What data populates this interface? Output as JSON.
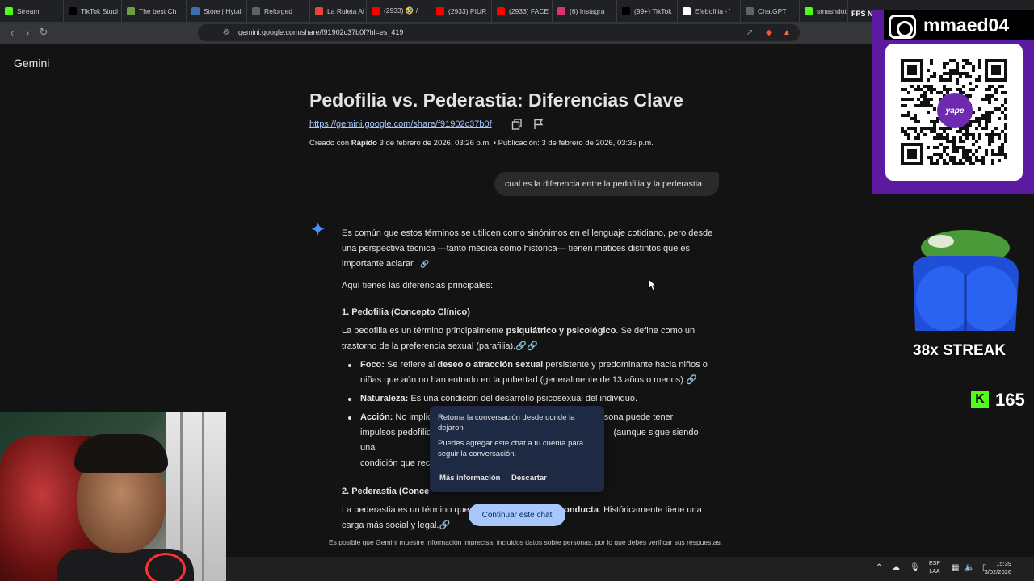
{
  "browser": {
    "tabs": [
      {
        "label": "Stream",
        "icon": "kick-icon",
        "color": "#53fc18"
      },
      {
        "label": "TikTok Studi",
        "icon": "tiktok-icon",
        "color": "#000000"
      },
      {
        "label": "The best Ch",
        "icon": "chess-icon",
        "color": "#6c9d41"
      },
      {
        "label": "Store | Hytal",
        "icon": "hytale-icon",
        "color": "#3b6fb6"
      },
      {
        "label": "Reforged",
        "icon": "reforged-icon",
        "color": "#5f6368"
      },
      {
        "label": "La Ruleta Al",
        "icon": "wheel-icon",
        "color": "#e8453c"
      },
      {
        "label": "(2933) 🤣 /",
        "icon": "youtube-icon",
        "color": "#ff0000"
      },
      {
        "label": "(2933) PIUR",
        "icon": "youtube-icon",
        "color": "#ff0000"
      },
      {
        "label": "(2933) FACE",
        "icon": "youtube-icon",
        "color": "#ff0000"
      },
      {
        "label": "(6) Instagra",
        "icon": "instagram-icon",
        "color": "#e1306c"
      },
      {
        "label": "(99+) TikTok",
        "icon": "tiktok-icon",
        "color": "#000000"
      },
      {
        "label": "Efebofilia - '",
        "icon": "wikipedia-icon",
        "color": "#ffffff"
      },
      {
        "label": "ChatGPT",
        "icon": "chatgpt-icon",
        "color": "#5f6368"
      },
      {
        "label": "smashdota",
        "icon": "kick-icon",
        "color": "#53fc18"
      }
    ],
    "fps_label": "FPS",
    "fps_value": "N/A",
    "url": "gemini.google.com/share/f91902c37b0f?hl=es_419"
  },
  "page": {
    "brand": "Gemini",
    "title": "Pedofilia vs. Pederastia: Diferencias Clave",
    "share_link": "https://gemini.google.com/share/f91902c37b0f",
    "meta_prefix": "Creado con",
    "meta_model": "Rápido",
    "meta_rest": "3 de febrero de 2026, 03:26 p.m. • Publicación: 3 de febrero de 2026, 03:35 p.m.",
    "user_prompt": "cual es la diferencia entre la pedofilia y la pederastia",
    "intro": "Es común que estos términos se utilicen como sinónimos en el lenguaje cotidiano, pero desde una perspectiva técnica —tanto médica como histórica— tienen matices distintos que es importante aclarar.",
    "lead": "Aquí tienes las diferencias principales:",
    "section1_heading": "1. Pedofilia (Concepto Clínico)",
    "section1_p_start": "La pedofilia es un término principalmente",
    "section1_p_bold": "psiquiátrico y psicológico",
    "section1_p_end": ". Se define como un trastorno de la preferencia sexual (parafilia).",
    "bullet1_label": "Foco:",
    "bullet1_start": "Se refiere al",
    "bullet1_bold": "deseo o atracción sexual",
    "bullet1_end": "persistente y predominante hacia niños o niñas que aún no han entrado en la pubertad (generalmente de 13 años o menos).",
    "bullet2_label": "Naturaleza:",
    "bullet2_text": "Es una condición del desarrollo psicosexual del individuo.",
    "bullet3_label": "Acción:",
    "bullet3_text": "No implic",
    "bullet3_text_b": "a persona puede tener",
    "bullet3_line2a": "impulsos pedofílic",
    "bullet3_line2b": "(aunque sigue siendo una",
    "bullet3_line3": "condición que rec",
    "section2_heading": "2. Pederastia (Conce",
    "section2_p_start": "La pederastia es un término que",
    "section2_p_bold": "describe el acto o la conducta",
    "section2_p_end": ". Históricamente tiene una carga más social y legal.",
    "disclaimer": "Es posible que Gemini muestre información imprecisa, incluidos datos sobre personas, por lo que debes verificar sus respuestas."
  },
  "popup": {
    "heading": "Retoma la conversación desde donde la dejaron",
    "body": "Puedes agregar este chat a tu cuenta para seguir la conversación.",
    "learn_more": "Más información",
    "dismiss": "Descartar"
  },
  "continue_button": "Continuar este chat",
  "taskbar": {
    "lang_top": "ESP",
    "lang_bottom": "LAA",
    "time": "15:39",
    "date": "3/02/2026"
  },
  "overlay": {
    "instagram_handle": "mmaed04",
    "qr_brand": "yape",
    "streak": "38x STREAK",
    "kick_count": "165"
  },
  "colors": {
    "page_bg": "#131314",
    "link": "#a8c7fa",
    "button_bg": "#a8c7fa",
    "popup_bg": "#1e2a44",
    "kick_green": "#53fc18",
    "overlay_purple": "#5b1aa0"
  }
}
